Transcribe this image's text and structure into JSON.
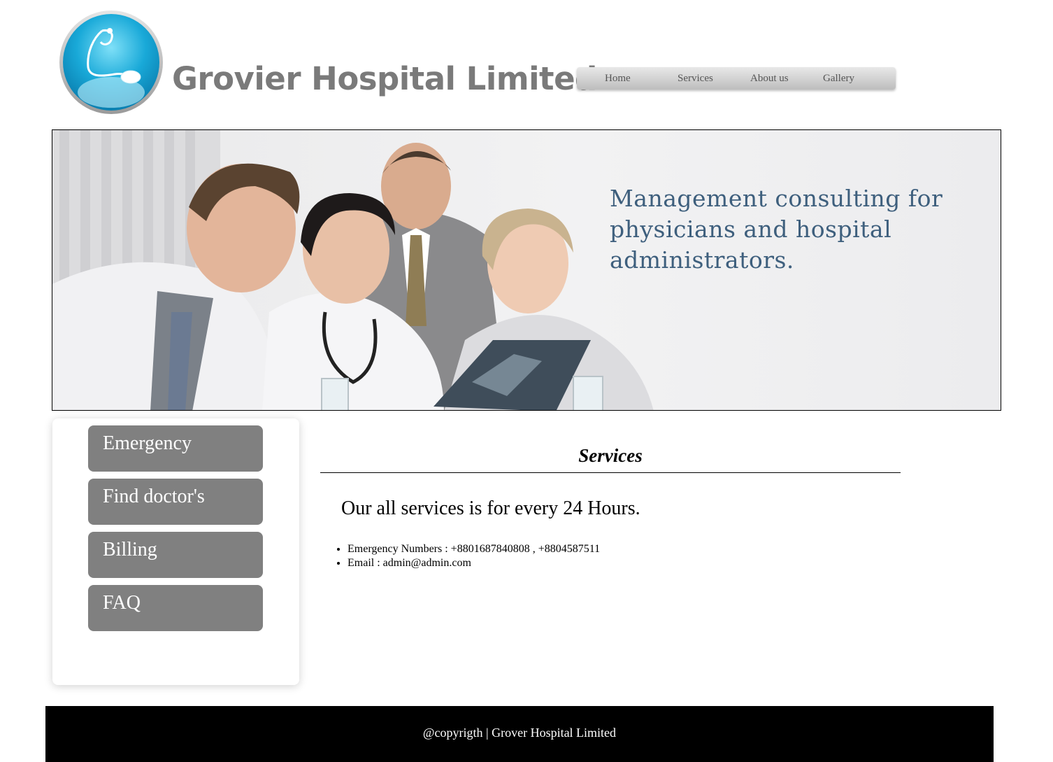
{
  "header": {
    "site_title": "Grovier Hospital Limited",
    "logo_icon": "stethoscope-mouse-icon"
  },
  "nav": {
    "items": [
      {
        "label": "Home"
      },
      {
        "label": "Services"
      },
      {
        "label": "About us"
      },
      {
        "label": "Gallery"
      }
    ]
  },
  "banner": {
    "text": "Management consulting for physicians and hospital administrators.",
    "image": "doctors-reviewing-xray-photo"
  },
  "sidebar": {
    "items": [
      {
        "label": "Emergency"
      },
      {
        "label": "Find doctor's"
      },
      {
        "label": "Billing"
      },
      {
        "label": "FAQ"
      }
    ]
  },
  "main": {
    "heading": "Services",
    "tagline": "Our all services is for every 24 Hours.",
    "info": [
      "Emergency Numbers : +8801687840808 , +8804587511",
      "Email : admin@admin.com"
    ]
  },
  "footer": {
    "text": "@copyrigth | Grover Hospital Limited"
  },
  "colors": {
    "title_gray": "#7a7a7a",
    "button_gray": "#808080",
    "logo_blue": "#1aa7d6",
    "banner_text": "#3e5f7d",
    "footer_bg": "#000000"
  }
}
